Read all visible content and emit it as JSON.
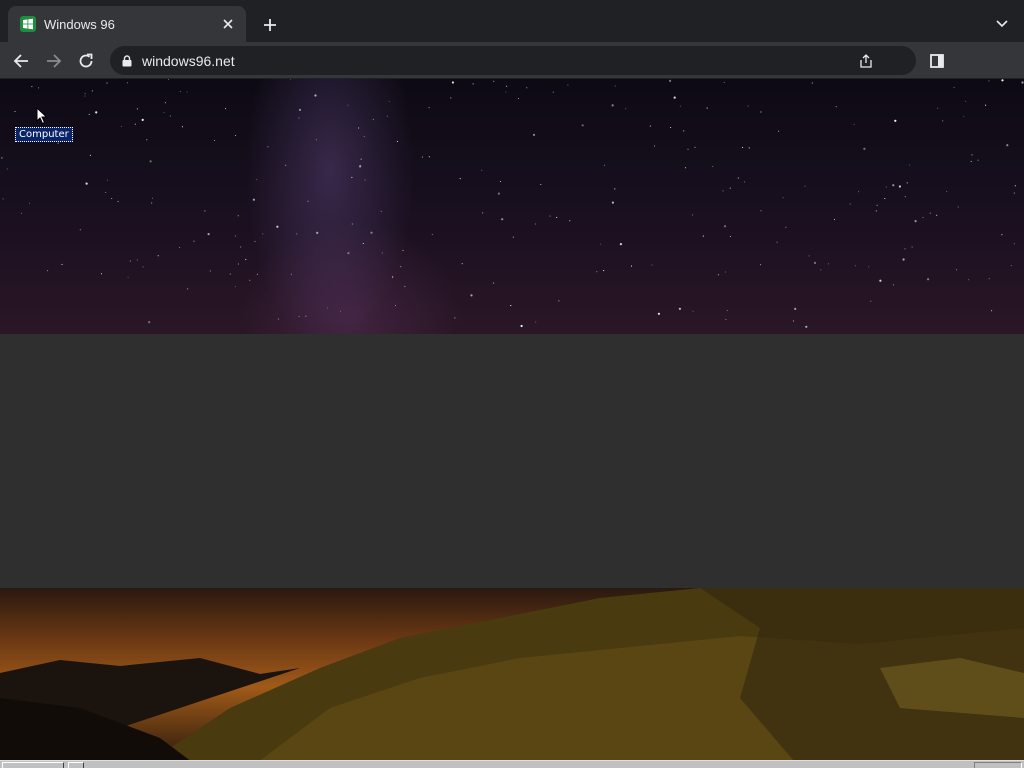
{
  "browser": {
    "tab_title": "Windows 96",
    "url": "windows96.net",
    "icons": {
      "favicon": "windows96-logo-icon",
      "close": "close-icon",
      "new_tab": "plus-icon",
      "tab_search": "chevron-down-icon",
      "back": "arrow-left-icon",
      "forward": "arrow-right-icon",
      "reload": "reload-icon",
      "lock": "lock-icon",
      "share": "share-icon",
      "side_panel": "side-panel-icon"
    }
  },
  "desktop": {
    "icons": [
      {
        "label": "Computer"
      }
    ]
  },
  "colors": {
    "chrome_dark": "#202124",
    "chrome_tab": "#35363a",
    "selection": "#0a246a",
    "favicon_green": "#1e8e3e"
  }
}
